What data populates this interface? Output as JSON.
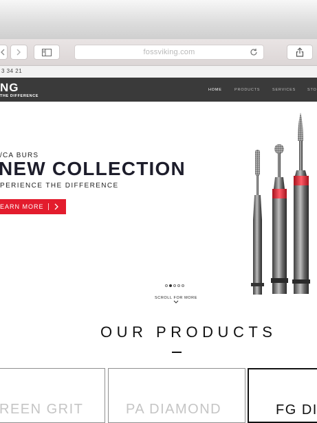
{
  "browser": {
    "url": "fossviking.com",
    "back_icon": "chevron-left-icon",
    "forward_icon": "chevron-right-icon",
    "sidebar_icon": "sidebar-icon",
    "reload_icon": "reload-icon",
    "share_icon": "share-icon"
  },
  "topbar": {
    "phone": "3 34 21"
  },
  "nav": {
    "logo": "NG",
    "tagline": "THE DIFFERENCE",
    "items": [
      "HOME",
      "PRODUCTS",
      "SERVICES",
      "STO"
    ],
    "active": "HOME"
  },
  "hero": {
    "eyebrow": "/CA BURS",
    "title": "NEW COLLECTION",
    "subtitle": "PERIENCE THE DIFFERENCE",
    "cta_label": "EARN MORE",
    "cta_icon": "chevron-right-icon",
    "slides": 5,
    "active_slide": 2,
    "scroll_label": "SCROLL FOR MORE",
    "accent_color": "#e31c2d"
  },
  "products": {
    "heading": "OUR PRODUCTS",
    "cards": [
      {
        "label": "REEN GRIT"
      },
      {
        "label": "PA DIAMOND"
      },
      {
        "label": "FG DI"
      }
    ]
  }
}
